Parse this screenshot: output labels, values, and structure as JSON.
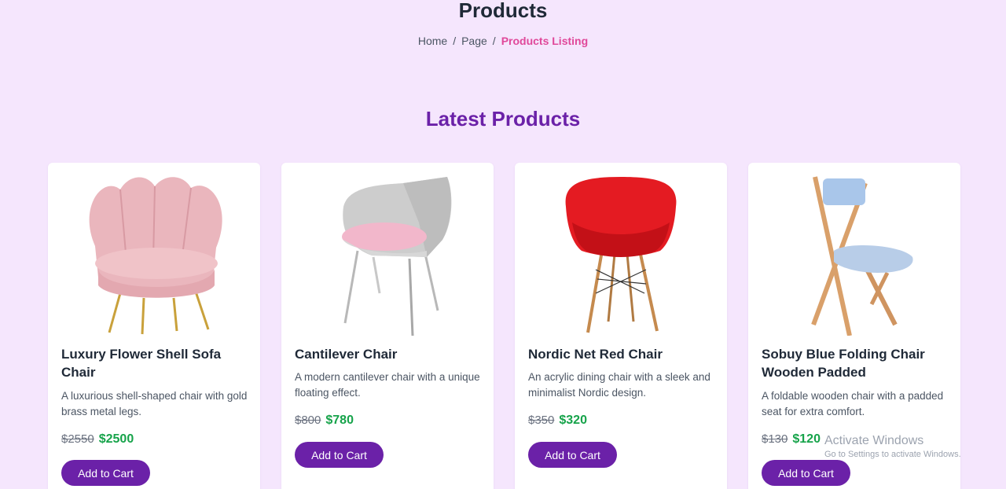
{
  "header": {
    "title": "Products",
    "breadcrumb": {
      "home": "Home",
      "separator": "/",
      "page": "Page",
      "current": "Products Listing"
    }
  },
  "section": {
    "title": "Latest Products"
  },
  "products": [
    {
      "name": "Luxury Flower Shell Sofa Chair",
      "description": "A luxurious shell-shaped chair with gold brass metal legs.",
      "old_price": "$2550",
      "price": "$2500",
      "cart_label": "Add to Cart",
      "image_icon": "pink-shell-armchair"
    },
    {
      "name": "Cantilever Chair",
      "description": "A modern cantilever chair with a unique floating effect.",
      "old_price": "$800",
      "price": "$780",
      "cart_label": "Add to Cart",
      "image_icon": "grey-cantilever-chair"
    },
    {
      "name": "Nordic Net Red Chair",
      "description": "An acrylic dining chair with a sleek and minimalist Nordic design.",
      "old_price": "$350",
      "price": "$320",
      "cart_label": "Add to Cart",
      "image_icon": "red-eiffel-chair"
    },
    {
      "name": "Sobuy Blue Folding Chair Wooden Padded",
      "description": "A foldable wooden chair with a padded seat for extra comfort.",
      "old_price": "$130",
      "price": "$120",
      "cart_label": "Add to Cart",
      "image_icon": "blue-folding-chair"
    }
  ],
  "watermark": {
    "line1": "Activate Windows",
    "line2": "Go to Settings to activate Windows."
  },
  "colors": {
    "background": "#f5e6fd",
    "accent": "#6b21a8",
    "breadcrumb_active": "#e0489a",
    "price": "#16a34a"
  }
}
